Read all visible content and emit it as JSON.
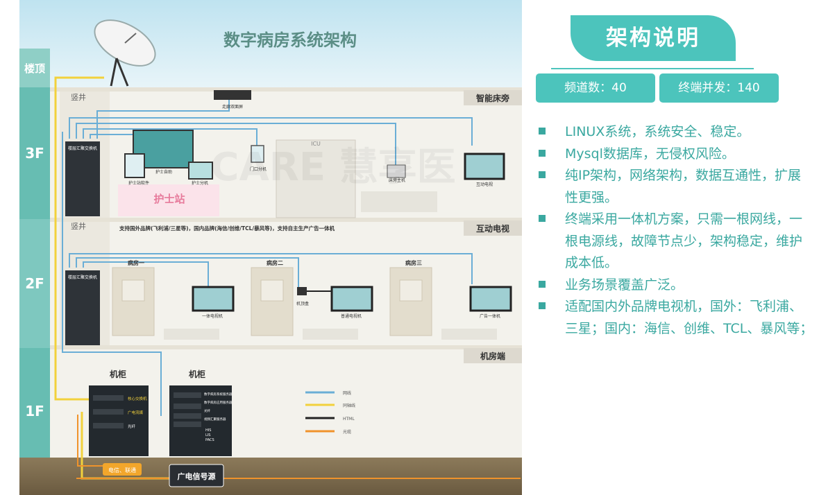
{
  "diagram": {
    "title": "数字病房系统架构",
    "floors": [
      "楼顶",
      "3F",
      "2F",
      "1F"
    ],
    "sections": {
      "bedside": "智能床旁",
      "tv": "互动电视",
      "machine_room": "机房端"
    },
    "shaft": "竖井",
    "devices_3f": {
      "corridor_screen": "走廊双面屏",
      "door": "门口分机",
      "nurse_host": "护士自助",
      "nurse_sw": "护士站软件",
      "nurse_ext": "护士分机",
      "nurse_station": "护士站",
      "icu": "ICU",
      "bed_host": "床旁主机",
      "tv": "互动电视",
      "switch": "楼层汇聚交换机"
    },
    "brands_note": "支持国外品牌(飞利浦/三星等)，国内品牌(海信/创维/TCL/暴风等)，支持自主生产广告一体机",
    "rooms": [
      "病房一",
      "病房二",
      "病房三"
    ],
    "devices_2f": {
      "aio": "一体电视机",
      "stb": "机顶盒",
      "tv": "普通电视机",
      "ad": "广告一体机"
    },
    "cabinets": [
      "机柜",
      "机柜"
    ],
    "rack_a": [
      "核心交换机",
      "广电流媒",
      "光纤"
    ],
    "rack_b": [
      "数字病房系统服务器",
      "数字病房应用服务器",
      "光纤",
      "视频汇聚服务器"
    ],
    "his": [
      "HIS",
      "LIS",
      "PACS"
    ],
    "legend": [
      "网线",
      "同轴线",
      "HTML",
      "光缆"
    ],
    "telecom": "电信、联通",
    "signal": "广电信号源",
    "watermark": "CARE 慧享医"
  },
  "panel": {
    "header": "架构说明",
    "stats": [
      "频道数：40",
      "终端并发：140"
    ],
    "bullets": [
      "LINUX系统，系统安全、稳定。",
      "Mysql数据库，无侵权风险。",
      "纯IP架构，网络架构，数据互通性，扩展性更强。",
      "终端采用一体机方案，只需一根网线，一根电源线，故障节点少，架构稳定，维护成本低。",
      "业务场景覆盖广泛。",
      "适配国内外品牌电视机，国外：飞利浦、三星；国内：海信、创维、TCL、暴风等；"
    ]
  },
  "colors": {
    "accent": "#4cc4bc",
    "accent_text": "#3aa8a0",
    "net_blue": "#6aaed6",
    "coax_yellow": "#f2d13c",
    "fiber_orange": "#f0932b"
  }
}
